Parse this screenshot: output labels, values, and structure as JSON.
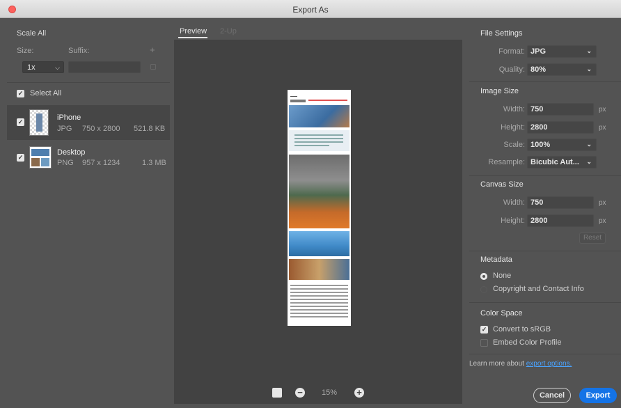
{
  "window": {
    "title": "Export As"
  },
  "left": {
    "scale_all": "Scale All",
    "size_label": "Size:",
    "suffix_label": "Suffix:",
    "plus": "+",
    "size_value": "1x",
    "select_all": "Select All",
    "assets": [
      {
        "name": "iPhone",
        "format": "JPG",
        "dims": "750 x 2800",
        "size": "521.8 KB"
      },
      {
        "name": "Desktop",
        "format": "PNG",
        "dims": "957 x 1234",
        "size": "1.3 MB"
      }
    ]
  },
  "center": {
    "tabs": [
      "Preview",
      "2-Up"
    ],
    "zoom": "15%"
  },
  "right": {
    "file_settings": "File Settings",
    "format_label": "Format:",
    "format_value": "JPG",
    "quality_label": "Quality:",
    "quality_value": "80%",
    "image_size": "Image Size",
    "width_label": "Width:",
    "width_value": "750",
    "height_label": "Height:",
    "height_value": "2800",
    "scale_label": "Scale:",
    "scale_value": "100%",
    "resample_label": "Resample:",
    "resample_value": "Bicubic Aut...",
    "unit": "px",
    "canvas_size": "Canvas Size",
    "canvas_width_label": "Width:",
    "canvas_width_value": "750",
    "canvas_height_label": "Height:",
    "canvas_height_value": "2800",
    "reset": "Reset",
    "metadata": "Metadata",
    "meta_none": "None",
    "meta_copyright": "Copyright and Contact Info",
    "color_space": "Color Space",
    "convert_srgb": "Convert to sRGB",
    "embed_profile": "Embed Color Profile",
    "learn_more": "Learn more about",
    "export_options": "export options."
  },
  "buttons": {
    "cancel": "Cancel",
    "export": "Export"
  },
  "colors": {
    "accent": "#1473e6",
    "link": "#4aa3ff",
    "panel": "#535353",
    "preview_bg": "#424242"
  }
}
